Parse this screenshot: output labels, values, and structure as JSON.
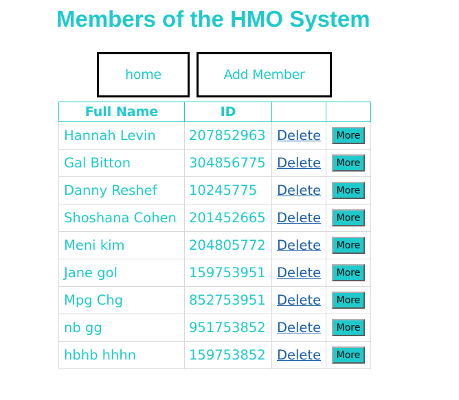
{
  "page": {
    "title": "Members of the HMO System"
  },
  "nav": {
    "home_label": "home",
    "add_member_label": "Add Member"
  },
  "table": {
    "headers": [
      "Full Name",
      "ID",
      "",
      ""
    ],
    "delete_label": "Delete",
    "more_label": "More",
    "rows": [
      {
        "name": "Hannah Levin",
        "id": "207852963"
      },
      {
        "name": "Gal Bitton",
        "id": "304856775"
      },
      {
        "name": "Danny Reshef",
        "id": "10245775"
      },
      {
        "name": "Shoshana Cohen",
        "id": "201452665"
      },
      {
        "name": "Meni kim",
        "id": "204805772"
      },
      {
        "name": "Jane gol",
        "id": "159753951"
      },
      {
        "name": "Mpg Chg",
        "id": "852753951"
      },
      {
        "name": "nb gg",
        "id": "951753852"
      },
      {
        "name": "hbhb hhhn",
        "id": "159753852"
      }
    ]
  },
  "colors": {
    "accent": "#1fcacc",
    "link": "#1a5fa5"
  }
}
